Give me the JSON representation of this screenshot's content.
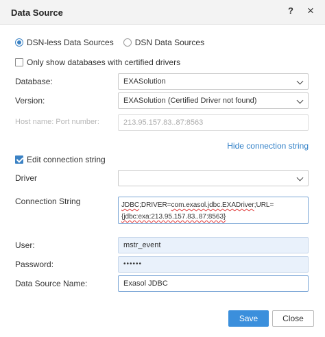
{
  "dialog": {
    "title": "Data Source",
    "help_label": "?",
    "close_label": "×"
  },
  "source_type": {
    "options": [
      "DSN-less Data Sources",
      "DSN Data Sources"
    ],
    "selected": "DSN-less Data Sources"
  },
  "certified_only": {
    "label": "Only show databases with certified drivers",
    "checked": false
  },
  "database": {
    "label": "Database:",
    "value": "EXASolution"
  },
  "version": {
    "label": "Version:",
    "value": "EXASolution (Certified Driver not found)"
  },
  "host": {
    "label": "Host name: Port number:",
    "value": "213.95.157.83..87:8563",
    "disabled": true
  },
  "hide_connection_link": "Hide connection string",
  "edit_connection": {
    "label": "Edit connection string",
    "checked": true
  },
  "driver": {
    "label": "Driver",
    "value": ""
  },
  "connection_string": {
    "label": "Connection String",
    "line1_a": "JDBC",
    "line1_b": ";DRIVER=",
    "line1_c": "com.exasol.jdbc.EXADriver",
    "line1_d": ";URL=",
    "line2": "{jdbc:exa:213.95.157.83..87:8563}"
  },
  "user": {
    "label": "User:",
    "value": "mstr_event"
  },
  "password": {
    "label": "Password:",
    "value": "••••••"
  },
  "data_source_name": {
    "label": "Data Source Name:",
    "value": "Exasol JDBC"
  },
  "buttons": {
    "save": "Save",
    "close": "Close"
  },
  "colors": {
    "accent": "#3b8fdc",
    "link": "#2f7fc7",
    "autofill": "#e9f1fb"
  }
}
